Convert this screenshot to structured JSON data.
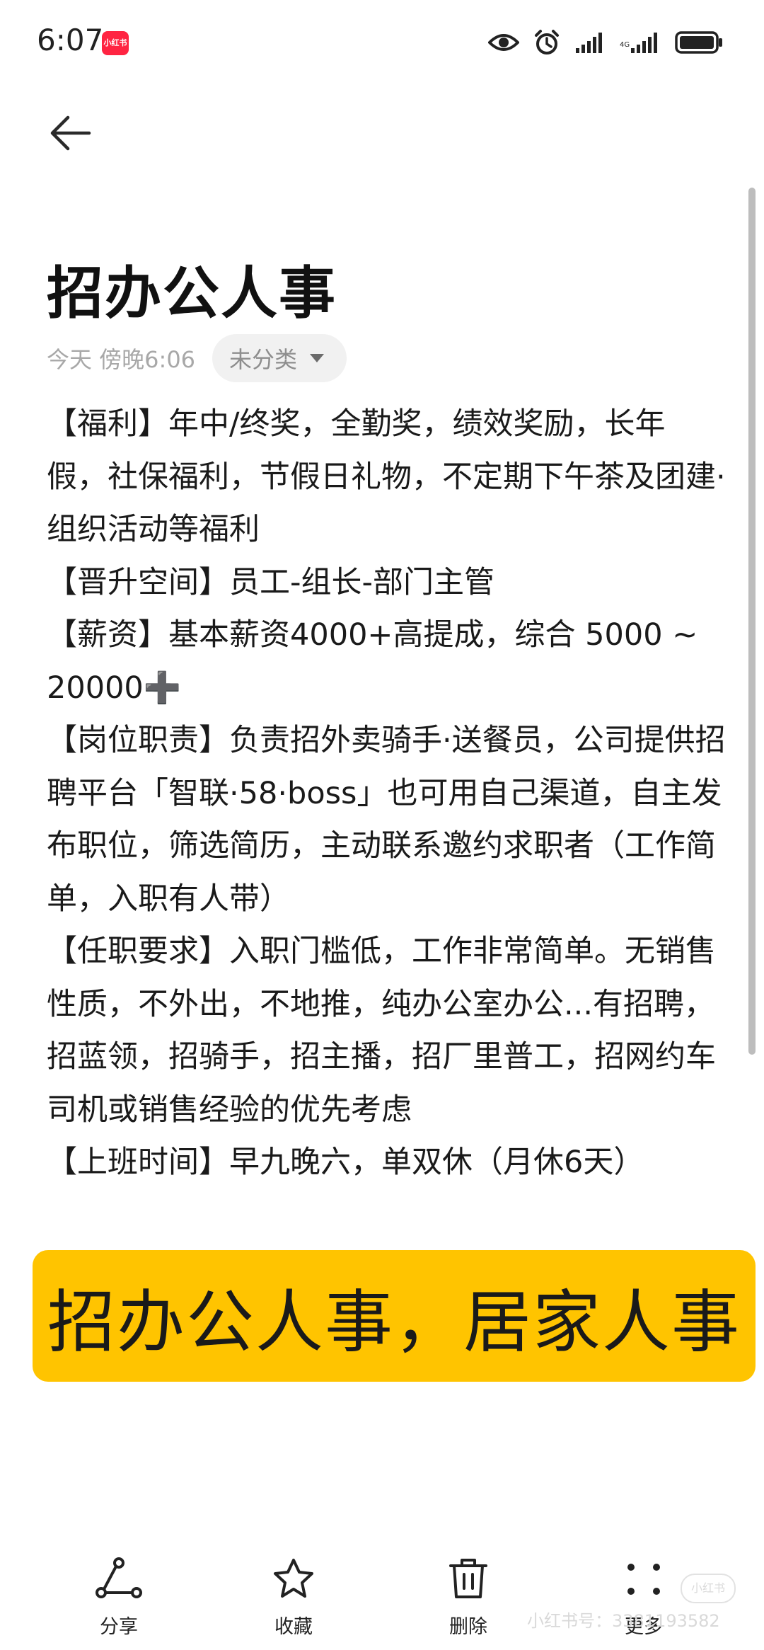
{
  "status_bar": {
    "time": "6:07",
    "app_badge": "小红书",
    "icons": [
      "eye-icon",
      "alarm-icon",
      "signal-icon",
      "signal-icon",
      "battery-icon"
    ]
  },
  "header": {
    "back_icon": "arrow-left-icon"
  },
  "note": {
    "title": "招办公人事",
    "time": "今天 傍晚6:06",
    "category": "未分类",
    "paragraphs": [
      "【福利】年中/终奖，全勤奖，绩效奖励，长年假，社保福利，节假日礼物，不定期下午茶及团建·组织活动等福利",
      "【晋升空间】员工-组长-部门主管",
      "【薪资】基本薪资4000+高提成，综合 5000 ~ 20000➕",
      "【岗位职责】负责招外卖骑手·送餐员，公司提供招聘平台「智联·58·boss」也可用自己渠道，自主发布职位，筛选简历，主动联系邀约求职者（工作简单，入职有人带）",
      "【任职要求】入职门槛低，工作非常简单。无销售性质，不外出，不地推，纯办公室办公...有招聘，招蓝领，招骑手，招主播，招厂里普工，招网约车司机或销售经验的优先考虑",
      "【上班时间】早九晚六，单双休（月休6天）"
    ]
  },
  "banner": {
    "text": "招办公人事，居家人事",
    "color": "#ffc400"
  },
  "toolbar": {
    "share": "分享",
    "favorite": "收藏",
    "delete": "删除",
    "more": "更多"
  },
  "watermark": {
    "logo": "小红书",
    "text": "小红书号：3381193582"
  }
}
